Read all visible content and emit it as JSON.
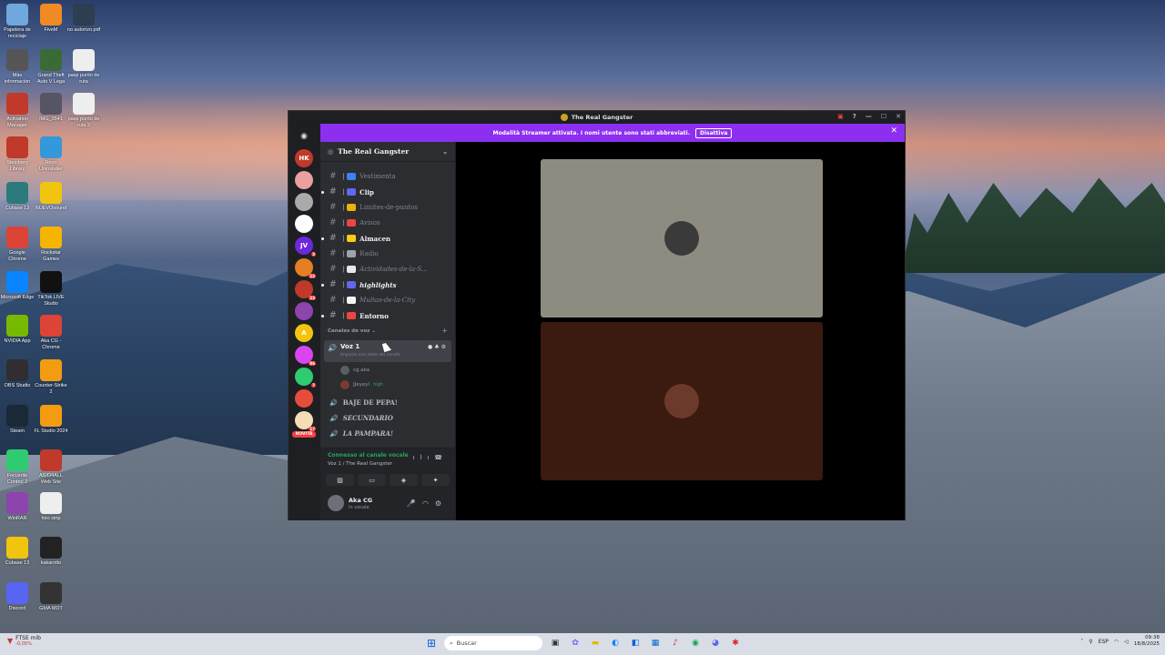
{
  "desktop_icons": [
    {
      "label": "Papelera de reciclaje",
      "color": "#6fa8dc"
    },
    {
      "label": "FiveM",
      "color": "#f08a24"
    },
    {
      "label": "no autorizo.pdf",
      "color": "#2c3e50"
    },
    {
      "label": "Más información",
      "color": "#555"
    },
    {
      "label": "Grand Theft Auto V Lega",
      "color": "#3a6b35"
    },
    {
      "label": "pasp punto de ruta",
      "color": "#eee"
    },
    {
      "label": "Activation Manager",
      "color": "#c0392b"
    },
    {
      "label": "IMG_3541",
      "color": "#556"
    },
    {
      "label": "pasp punto de ruta 2",
      "color": "#eee"
    },
    {
      "label": "Steinberg Library",
      "color": "#c0392b"
    },
    {
      "label": "Revo Uninstaller",
      "color": "#3498db"
    },
    {
      "label": "Cubase 13",
      "color": "#2c7a7b"
    },
    {
      "label": "NUEVOsound",
      "color": "#f1c40f"
    },
    {
      "label": "Google Chrome",
      "color": "#db4437"
    },
    {
      "label": "Rockstar Games",
      "color": "#f5b400"
    },
    {
      "label": "Microsoft Edge",
      "color": "#0a84ff"
    },
    {
      "label": "TikTok LIVE Studio",
      "color": "#111"
    },
    {
      "label": "NVIDIA App",
      "color": "#76b900"
    },
    {
      "label": "Aka CG - Chrome",
      "color": "#db4437"
    },
    {
      "label": "OBS Studio",
      "color": "#302e31"
    },
    {
      "label": "Counter-Strike 2",
      "color": "#f39c12"
    },
    {
      "label": "Steam",
      "color": "#1b2838"
    },
    {
      "label": "FL Studio 2024",
      "color": "#f39c12"
    },
    {
      "label": "Focusrite Control 2",
      "color": "#2ecc71"
    },
    {
      "label": "ASIO4ALL Web Site",
      "color": "#c0392b"
    },
    {
      "label": "WinRAR",
      "color": "#8e44ad"
    },
    {
      "label": "foto strip",
      "color": "#eee"
    },
    {
      "label": "Cubase 13",
      "color": "#f1c40f"
    },
    {
      "label": "kakarotto",
      "color": "#222"
    },
    {
      "label": "Discord",
      "color": "#5865f2"
    },
    {
      "label": "GMA MDT",
      "color": "#333"
    }
  ],
  "window": {
    "title": "The Real Gangster",
    "controls": [
      "—",
      "☐",
      "✕"
    ]
  },
  "banner": {
    "text": "Modalità Streamer attivata. I nomi utente sono stati abbreviati.",
    "button": "Disattiva"
  },
  "servers": [
    {
      "label": "HK",
      "color": "#c0392b",
      "badge": ""
    },
    {
      "label": "",
      "color": "#e8a0a0",
      "badge": ""
    },
    {
      "label": "",
      "color": "#aaa",
      "badge": ""
    },
    {
      "label": "",
      "color": "#fff",
      "badge": ""
    },
    {
      "label": "JV",
      "color": "#6d28d9",
      "badge": "5"
    },
    {
      "label": "",
      "color": "#e67e22",
      "badge": "22"
    },
    {
      "label": "",
      "color": "#c0392b",
      "badge": "23"
    },
    {
      "label": "",
      "color": "#8e44ad",
      "badge": ""
    },
    {
      "label": "A",
      "color": "#f1c40f",
      "badge": ""
    },
    {
      "label": "",
      "color": "#d946ef",
      "badge": "96"
    },
    {
      "label": "",
      "color": "#2ecc71",
      "badge": "7"
    },
    {
      "label": "",
      "color": "#e74c3c",
      "badge": ""
    },
    {
      "label": "",
      "color": "#f5deb3",
      "badge": "17"
    }
  ],
  "novita": "NOVITÀ",
  "guild": {
    "name": "The Real Gangster"
  },
  "text_channels": [
    {
      "name": "Vestimenta",
      "bold": false,
      "italic": false,
      "emoji_color": "#3b82f6"
    },
    {
      "name": "Clip",
      "bold": true,
      "italic": false,
      "emoji_color": "#6366f1"
    },
    {
      "name": "Limites-de-puntos",
      "bold": false,
      "italic": false,
      "emoji_color": "#eab308"
    },
    {
      "name": "Avisos",
      "bold": false,
      "italic": false,
      "emoji_color": "#ef4444"
    },
    {
      "name": "Almacen",
      "bold": true,
      "italic": false,
      "emoji_color": "#facc15"
    },
    {
      "name": "Radio",
      "bold": false,
      "italic": false,
      "emoji_color": "#9ca3af"
    },
    {
      "name": "Actividades-de-la-S...",
      "bold": false,
      "italic": true,
      "emoji_color": "#e5e7eb"
    },
    {
      "name": "highlights",
      "bold": true,
      "italic": true,
      "emoji_color": "#6366f1"
    },
    {
      "name": "Multas-de-la-City",
      "bold": false,
      "italic": true,
      "emoji_color": "#f5f5f4"
    },
    {
      "name": "Entorno",
      "bold": true,
      "italic": false,
      "emoji_color": "#ef4444"
    }
  ],
  "voice_category": "Canales de voz",
  "voice_channel": {
    "name": "Voz 1",
    "status": "Imposta uno stato del canale"
  },
  "members": [
    {
      "name": "cg.aka",
      "tag": ""
    },
    {
      "name": "JJeyeyl",
      "tag": "high"
    }
  ],
  "other_voice": [
    {
      "name": "BAJE DE PEPA!",
      "italic": false
    },
    {
      "name": "SECUNDARIO",
      "italic": true
    },
    {
      "name": "LA PAMPARA!",
      "italic": true
    }
  ],
  "voice_panel": {
    "connected": "Connesso al canale vocale",
    "channel": "Voz 1 / The Real Gangster"
  },
  "user": {
    "name": "Aka CG",
    "status": "In vocale"
  },
  "tiles": [
    {
      "bg": "#8e8b80",
      "avatar": "#3a3a3a"
    },
    {
      "bg": "#3b1a10",
      "avatar": "#6b3a2a"
    }
  ],
  "taskbar": {
    "temp": "FTSE mib",
    "change": "-0,05%",
    "search_placeholder": "Buscar",
    "lang": "ESP",
    "time": "09:38",
    "date": "18/8/2025"
  }
}
